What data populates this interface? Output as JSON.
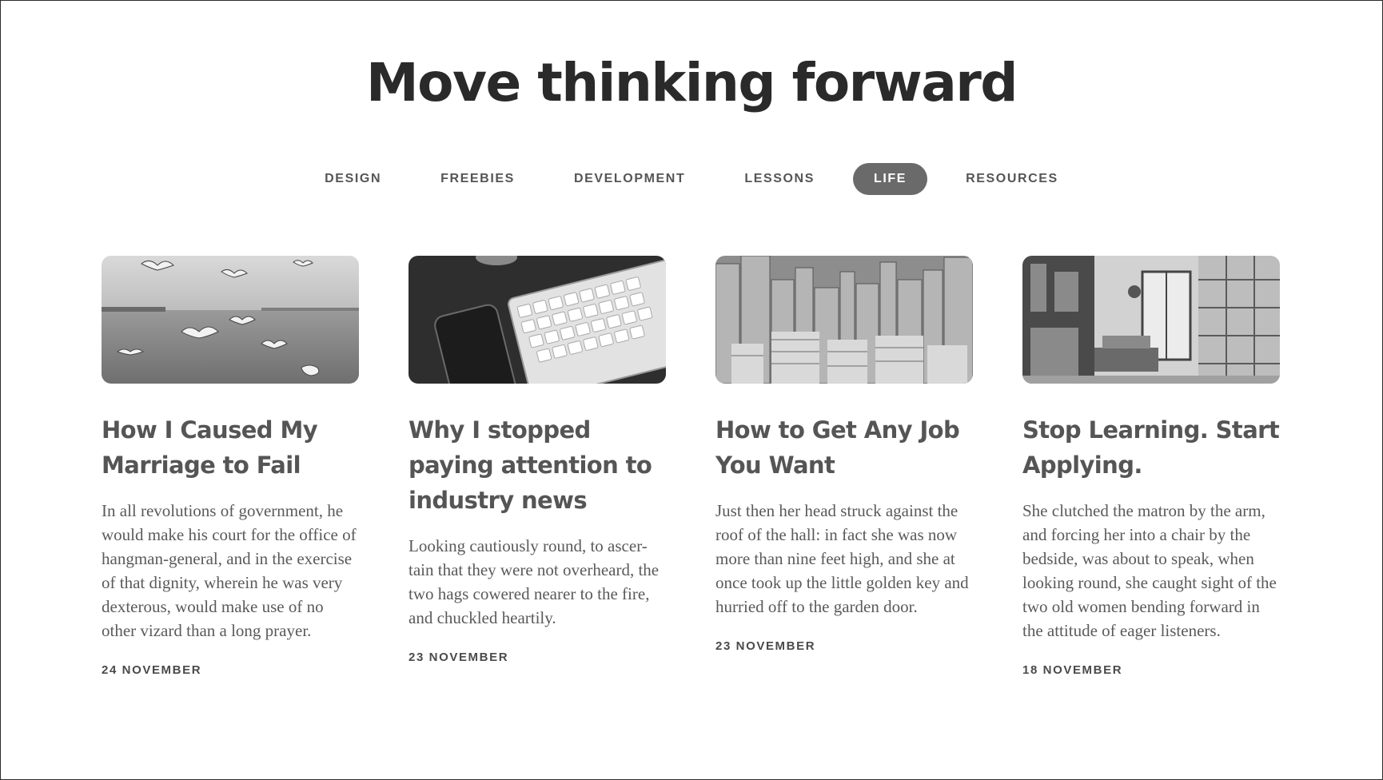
{
  "headline": "Move thinking forward",
  "nav": {
    "items": [
      "DESIGN",
      "FREEBIES",
      "DEVELOPMENT",
      "LESSONS",
      "LIFE",
      "RESOURCES"
    ],
    "active": "LIFE"
  },
  "cards": [
    {
      "image": "seagulls-over-sea-photo",
      "title": "How I Caused My Marriage to Fail",
      "body": "In all revolutions of government, he would make his court for the office of hangman-general, and in the exercise of that dignity, wherein he was very dexterous, would make use of no other vizard than a long prayer.",
      "date": "24 NOVEMBER"
    },
    {
      "image": "keyboard-and-phone-photo",
      "title": "Why I stopped paying attention to industry news",
      "body": "Looking cautiously round, to ascer-tain that they were not overheard, the two hags cowered nearer to the fire, and chuckled heartily.",
      "date": "23 NOVEMBER"
    },
    {
      "image": "city-skyline-photo",
      "title": "How to Get Any Job You Want",
      "body": "Just then her head struck against the roof of the hall: in fact she was now more than nine feet high, and she at once took up the little golden key and hurried off to the garden door.",
      "date": "23 NOVEMBER"
    },
    {
      "image": "office-interior-photo",
      "title": "Stop Learning. Start Applying.",
      "body": "She clutched the matron by the arm, and forcing her into a chair by the bedside, was about to speak, when looking round, she caught sight of the two old women bending forward in the attitude of eager listeners.",
      "date": "18 NOVEMBER"
    }
  ]
}
